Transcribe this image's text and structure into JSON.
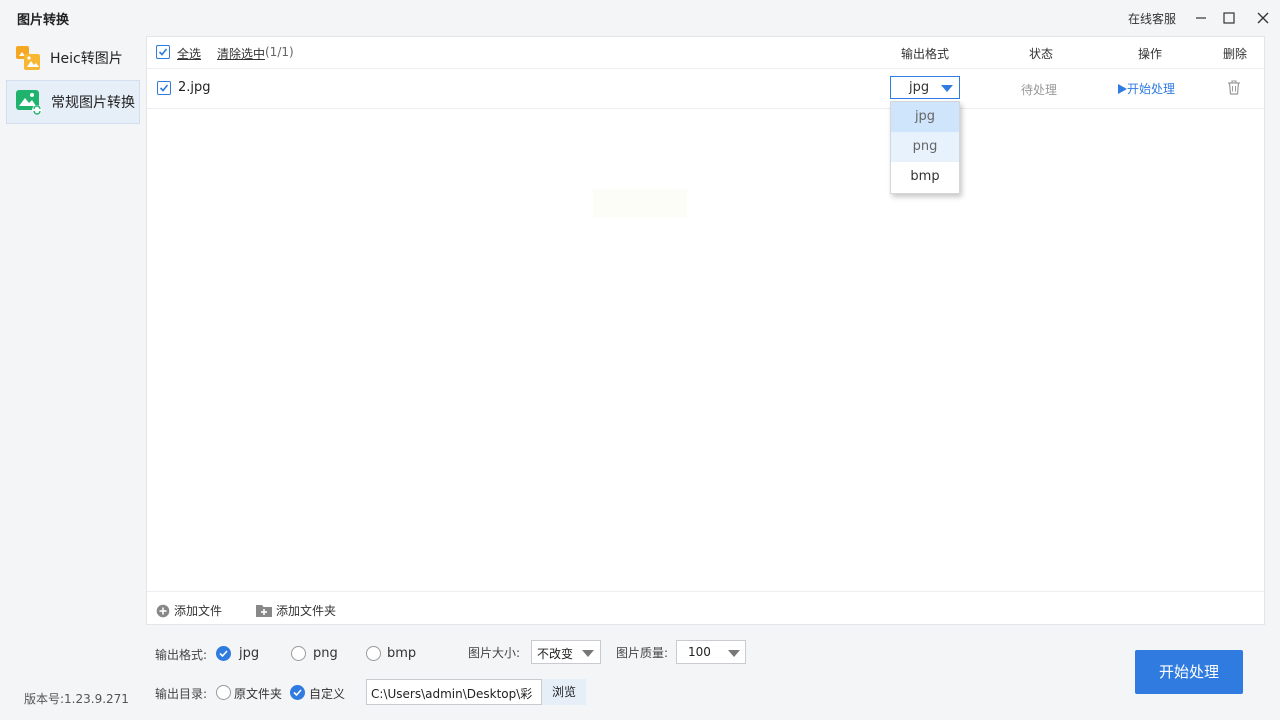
{
  "window": {
    "title": "图片转换",
    "online_service": "在线客服"
  },
  "sidebar": {
    "items": [
      {
        "label": "Heic转图片",
        "icon": "heic-image-icon"
      },
      {
        "label": "常规图片转换",
        "icon": "image-convert-icon",
        "active": true
      }
    ],
    "version": "版本号:1.23.9.271"
  },
  "list": {
    "select_all": "全选",
    "clear_selected": "清除选中",
    "selected_count": "(1/1)",
    "columns": {
      "format": "输出格式",
      "status": "状态",
      "action": "操作",
      "delete": "删除"
    },
    "rows": [
      {
        "checked": true,
        "file_name": "2.jpg",
        "format": "jpg",
        "status": "待处理",
        "action": "开始处理"
      }
    ],
    "format_dropdown": {
      "open": true,
      "options": [
        "jpg",
        "png",
        "bmp"
      ],
      "selected": "jpg",
      "hovered": "png"
    }
  },
  "footer": {
    "add_file": "添加文件",
    "add_folder": "添加文件夹"
  },
  "options": {
    "format_label": "输出格式:",
    "formats": [
      "jpg",
      "png",
      "bmp"
    ],
    "selected_format": "jpg",
    "size_label": "图片大小:",
    "size_value": "不改变",
    "quality_label": "图片质量:",
    "quality_value": "100",
    "dir_label": "输出目录:",
    "dir_original": "原文件夹",
    "dir_custom": "自定义",
    "dir_selected": "自定义",
    "path_value": "C:\\Users\\admin\\Desktop\\彩",
    "browse": "浏览",
    "start": "开始处理"
  },
  "colors": {
    "accent": "#2f7be0",
    "background": "#f4f5f7",
    "dropdown_selected": "#cfe5fb"
  }
}
